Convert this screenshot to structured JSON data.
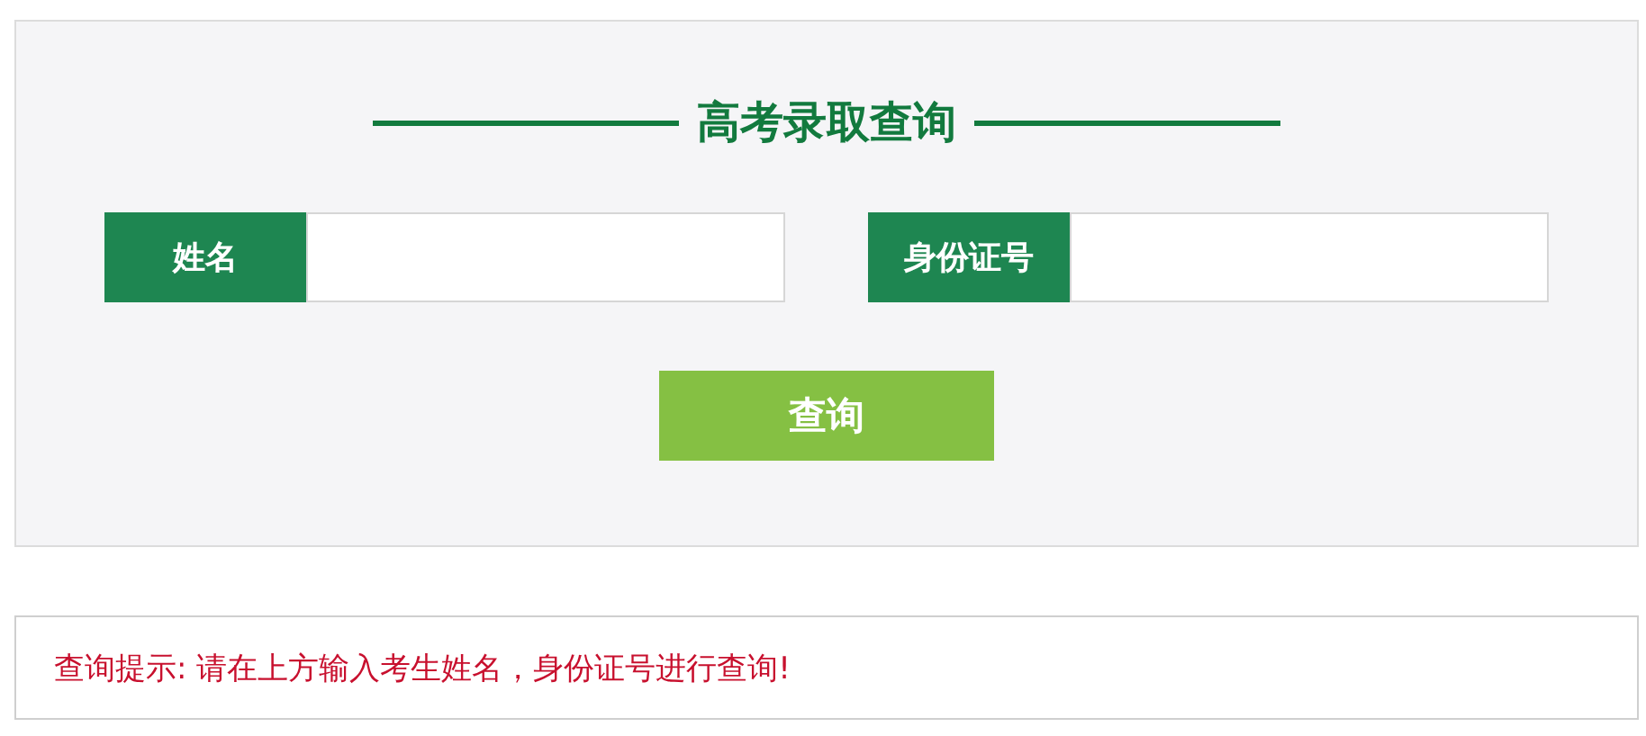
{
  "title": "高考录取查询",
  "fields": [
    {
      "label": "姓名"
    },
    {
      "label": "身份证号"
    }
  ],
  "button": "查询",
  "hint": "查询提示: 请在上方输入考生姓名，身份证号进行查询!"
}
